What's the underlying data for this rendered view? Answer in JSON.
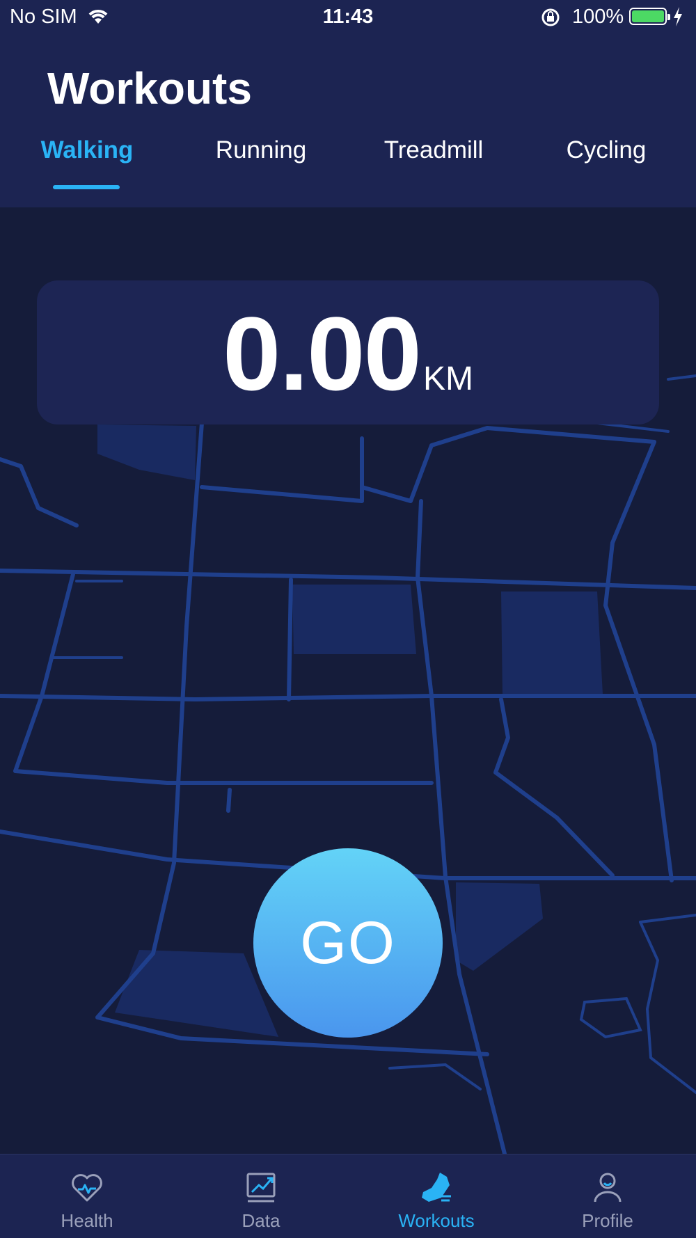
{
  "status_bar": {
    "carrier": "No SIM",
    "time": "11:43",
    "battery": "100%",
    "battery_level": 1.0,
    "icons": [
      "wifi-icon",
      "orientation-lock-icon",
      "battery-icon",
      "charging-bolt-icon"
    ]
  },
  "header": {
    "title": "Workouts",
    "tabs": [
      {
        "label": "Walking",
        "active": true
      },
      {
        "label": "Running",
        "active": false
      },
      {
        "label": "Treadmill",
        "active": false
      },
      {
        "label": "Cycling",
        "active": false
      }
    ]
  },
  "distance": {
    "value": "0.00",
    "unit": "KM"
  },
  "go_button": {
    "label": "GO"
  },
  "tabbar": {
    "items": [
      {
        "label": "Health",
        "icon": "heart-pulse-icon",
        "active": false
      },
      {
        "label": "Data",
        "icon": "chart-trend-icon",
        "active": false
      },
      {
        "label": "Workouts",
        "icon": "running-shoe-icon",
        "active": true
      },
      {
        "label": "Profile",
        "icon": "person-icon",
        "active": false
      }
    ]
  },
  "colors": {
    "background": "#151c3a",
    "header": "#1c2452",
    "accent": "#2ab3f5",
    "map_road": "#1f3f8c",
    "map_block": "#1a2c66",
    "go_gradient_top": "#63d3f7",
    "go_gradient_bottom": "#4a96ee",
    "inactive_tab_label": "#9aa0ba"
  }
}
